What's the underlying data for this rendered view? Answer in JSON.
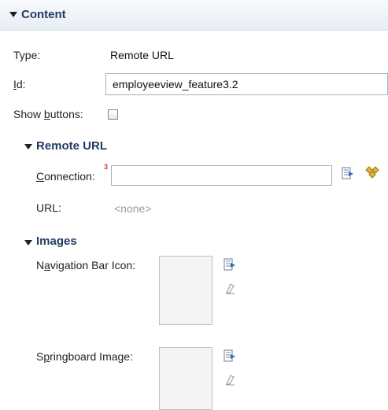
{
  "content": {
    "section_title": "Content",
    "type_label": "Type:",
    "type_value": "Remote URL",
    "id_label_prefix": "I",
    "id_label_rest": "d:",
    "id_value": "employeeview_feature3.2",
    "show_buttons_label_prefix": "Show ",
    "show_buttons_label_u": "b",
    "show_buttons_label_rest": "uttons:",
    "show_buttons_checked": false
  },
  "remote_url": {
    "section_title": "Remote URL",
    "connection_label_u": "C",
    "connection_label_rest": "onnection:",
    "connection_value": "",
    "error_marker": "3",
    "url_label": "URL:",
    "url_value": "<none>"
  },
  "images": {
    "section_title": "Images",
    "nav_icon_label_prefix": "N",
    "nav_icon_label_u": "a",
    "nav_icon_label_rest": "vigation Bar Icon:",
    "springboard_label_prefix": "S",
    "springboard_label_u": "p",
    "springboard_label_rest": "ringboard Image:"
  },
  "colors": {
    "header_text": "#1f3a5f",
    "error": "#d8332a",
    "muted_text": "#9a9a9a"
  }
}
